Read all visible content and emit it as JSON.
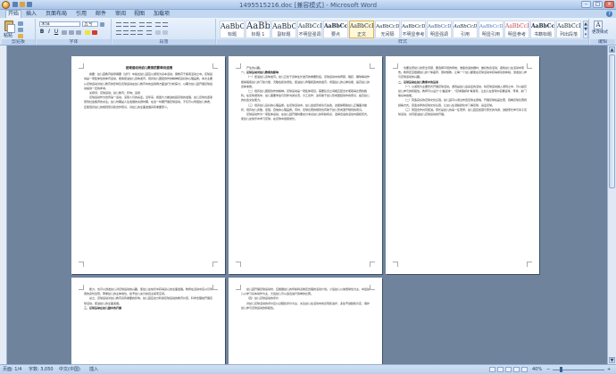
{
  "window": {
    "title": "1495515216.doc [兼容模式] - Microsoft Word",
    "minimize": "–",
    "maximize": "□",
    "close": "×"
  },
  "tabs": [
    {
      "label": "开始",
      "active": true
    },
    {
      "label": "插入"
    },
    {
      "label": "页面布局"
    },
    {
      "label": "引用"
    },
    {
      "label": "邮件"
    },
    {
      "label": "审阅"
    },
    {
      "label": "视图"
    },
    {
      "label": "加载项"
    }
  ],
  "help_label": "?",
  "ribbon": {
    "clipboard": {
      "paste_label": "粘贴",
      "group_label": "剪贴板"
    },
    "font": {
      "font_name": "宋体",
      "font_size": "五号",
      "group_label": "字体",
      "bold": "B",
      "italic": "I",
      "underline": "U"
    },
    "paragraph": {
      "group_label": "段落"
    },
    "styles": {
      "group_label": "样式",
      "items": [
        {
          "sample": "AaBbC",
          "name": "标题"
        },
        {
          "sample": "AaBb",
          "name": "标题 1"
        },
        {
          "sample": "AaBbC",
          "name": "副标题"
        },
        {
          "sample": "AaBbCcD",
          "name": "不明显强调"
        },
        {
          "sample": "AaBbCcD",
          "name": "要点"
        },
        {
          "sample": "AaBbCcD",
          "name": "正文",
          "selected": true
        },
        {
          "sample": "AaBbCcDc",
          "name": "无间隔"
        },
        {
          "sample": "AaBbCcDc",
          "name": "不明显参考"
        },
        {
          "sample": "AaBbCcDc",
          "name": "明显强调"
        },
        {
          "sample": "AaBbCcDc",
          "name": "引用"
        },
        {
          "sample": "AaBbCcDc",
          "name": "明显引用"
        },
        {
          "sample": "AaBbCcD",
          "name": "明显参考"
        },
        {
          "sample": "AaBbCcI",
          "name": "书籍标题"
        },
        {
          "sample": "AaBbCcI",
          "name": "列出段落"
        }
      ],
      "change_label": "更改样式"
    },
    "editing": {
      "group_label": "编辑",
      "find": "查找",
      "replace": "替换",
      "select": "选择"
    }
  },
  "document": {
    "pages": [
      {
        "paragraphs": [
          {
            "style": "title",
            "text": "足球运动对幼儿教育的影响与运用"
          },
          {
            "style": "body",
            "text": "摘要：幼儿园教育指导纲要（试行）中指出幼儿园应以游戏为基本活动，寓教育于各项活动之中。足球运动是一项集体性的体育运动，能够促进幼儿身体发育，培养幼儿团结协作的精神和良好的心理品质。本文主要从足球运动对幼儿教育的影响及足球运动在幼儿教育中的运用两方面进行分析探讨，以期为幼儿园开展足球运动提供一定的参考。"
          },
          {
            "style": "body",
            "text": "关键词：足球运动；幼儿教育；影响；运用"
          },
          {
            "style": "body",
            "text": "足球运动作为世界第一运动，深受人们的喜爱。近年来，我国大力推进校园足球的发展，幼儿足球也逐渐受到社会各界的关注。幼儿时期是人生发展的关键时期，在这一时期开展足球运动，不仅可以增强幼儿体质，还能培养幼儿的规则意识和合作意识，对幼儿的全面发展具有重要意义。"
          }
        ]
      },
      {
        "paragraphs": [
          {
            "style": "body",
            "text": "产生的兴趣。"
          },
          {
            "style": "head",
            "text": "一、足球运动对幼儿教育的影响"
          },
          {
            "style": "body",
            "text": "（一）促进幼儿身体发育。幼儿正处于身体生长发育的重要阶段，足球运动中的奔跑、跳跃、踢球等动作能够锻炼幼儿的下肢力量、灵敏性和协调性，促进幼儿骨骼和肌肉的发育，增强幼儿的心肺功能，提高幼儿的身体素质。"
          },
          {
            "style": "body",
            "text": "（二）培养幼儿团结协作的精神。足球运动是一项集体项目，需要队员之间相互配合才能取得比赛的胜利。在足球游戏中，幼儿需要学会与同伴沟通交流、分工合作，这有助于幼儿形成团结协作的意识，提高幼儿的社会交往能力。"
          },
          {
            "style": "body",
            "text": "（三）培养幼儿良好的心理品质。在足球活动中，幼儿会经历成功与失败，这能够帮助幼儿正确面对挫折，培养幼儿勇敢、坚强、自信的心理品质。同时，足球比赛的规则也有助于幼儿形成遵守规则的意识。"
          },
          {
            "style": "body",
            "text": "足球运动作为一项集体运动，在幼儿园开展时要充分考虑幼儿的年龄特点，选择合适的活动内容和形式，使幼儿在快乐中学习足球，在足球中健康成长。"
          }
        ]
      },
      {
        "paragraphs": [
          {
            "style": "body",
            "text": "也要注意幼儿的安全问题，要选择平坦的场地，准备合适的器材，做好热身活动，避免幼儿在活动中受伤。教师还应根据幼儿的个体差异，因材施教，让每一个幼儿都能在足球活动中获得成功的体验，激发幼儿参与足球运动的兴趣。"
          },
          {
            "style": "head",
            "text": "二、足球运动在幼儿教育中的运用"
          },
          {
            "style": "body",
            "text": "（一）以游戏为主要形式开展足球活动。游戏是幼儿最喜爱的活动，将足球运动融入游戏之中，可以提高幼儿参与的积极性。教师可以设计\"小猫运球\"、\"足球保龄球\"等游戏，让幼儿在游戏中掌握运球、传球、射门等基本技能。"
          },
          {
            "style": "body",
            "text": "（二）营造良好的足球文化氛围。幼儿园可以通过布置足球主题墙、开展足球绘画比赛、观看足球比赛视频等方式，营造浓厚的足球文化氛围，让幼儿在潜移默化中了解足球、喜爱足球。"
          },
          {
            "style": "body",
            "text": "（三）家园合作共同促进。家长是幼儿的第一任老师，幼儿园应加强与家长的沟通，鼓励家长参与亲子足球活动，共同促进幼儿足球运动的开展。"
          }
        ]
      },
      {
        "paragraphs": [
          {
            "style": "body",
            "text": "能力，也可以激发幼儿对足球运动的兴趣，使幼儿在快乐中获得身心的全面发展。教师在活动中应以引导者的身份出现，尊重幼儿的主体地位，给予幼儿充分的自主探索空间。"
          },
          {
            "style": "body",
            "text": "总之，足球运动对幼儿教育具有重要的影响，幼儿园应充分利用足球运动的教育价值，科学合理地开展足球活动，促进幼儿的全面发展。"
          },
          {
            "style": "head",
            "text": "三、足球运动在幼儿园中的开展"
          }
        ]
      },
      {
        "paragraphs": [
          {
            "style": "body",
            "text": "幼儿园开展足球运动时，应根据幼儿的年龄特点制定合理的活动计划。小班幼儿以熟悉球性为主，中班幼儿以学习基本动作为主，大班幼儿可以适当进行简单的比赛。"
          },
          {
            "style": "body",
            "text": "（四）幼儿足球运动的评价"
          },
          {
            "style": "body",
            "text": "对幼儿足球活动的评价应以过程性评价为主，关注幼儿在活动中的表现和进步，多给予鼓励和肯定，保护幼儿参与足球运动的积极性。"
          }
        ]
      }
    ]
  },
  "status_bar": {
    "page": "页面: 1/4",
    "words": "字数: 3,050",
    "language": "中文(中国)",
    "mode": "插入",
    "zoom": "40%",
    "zoom_minus": "−",
    "zoom_plus": "+"
  },
  "scroll": {
    "up": "▲",
    "down": "▼"
  }
}
